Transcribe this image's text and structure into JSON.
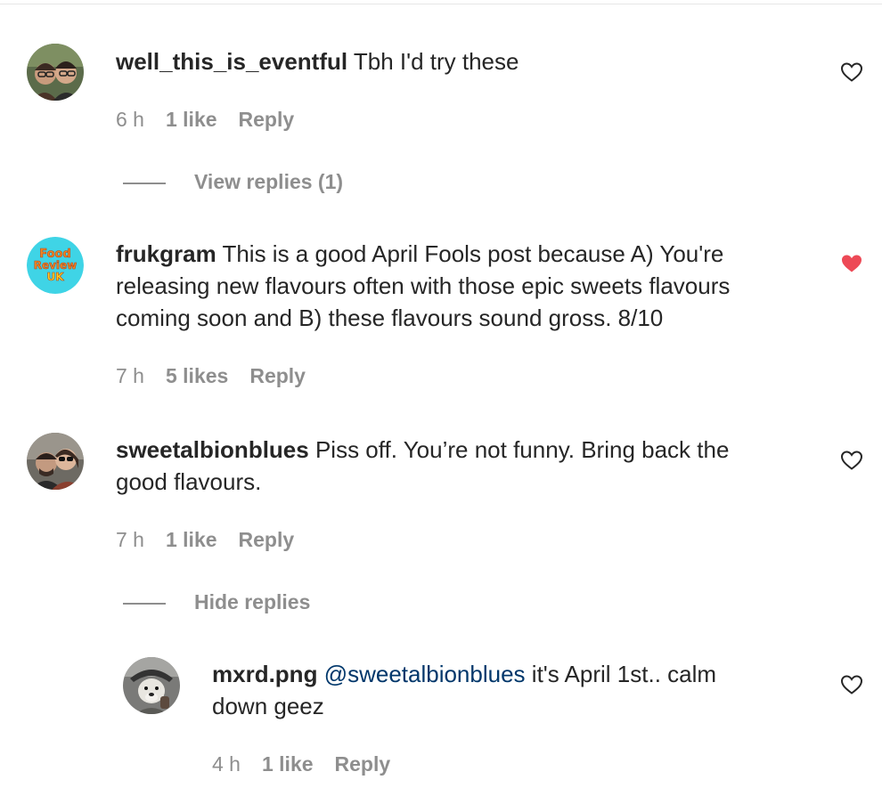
{
  "comments": [
    {
      "username": "well_this_is_eventful",
      "text": "Tbh I'd try these",
      "time": "6 h",
      "likes": "1 like",
      "reply": "Reply",
      "liked": false,
      "replies_toggle": "View replies (1)",
      "avatar_icon": "user-photo-avatar"
    },
    {
      "username": "frukgram",
      "text_line1": "This is a good April Fools post because A) You're",
      "text_line2": "releasing new flavours often with those epic sweets flavours",
      "text_line3": "coming soon and B) these flavours sound gross. 8/10",
      "time": "7 h",
      "likes": "5 likes",
      "reply": "Reply",
      "liked": true,
      "avatar_logo_text": [
        "Food",
        "Review",
        "UK"
      ]
    },
    {
      "username": "sweetalbionblues",
      "text_line1": "Piss off. You’re not funny. Bring back the",
      "text_line2": "good flavours.",
      "time": "7 h",
      "likes": "1 like",
      "reply": "Reply",
      "liked": false,
      "replies_toggle": "Hide replies",
      "avatar_icon": "user-photo-avatar"
    }
  ],
  "reply": {
    "username": "mxrd.png",
    "mention": "@sweetalbionblues",
    "text_line1": "it's April 1st.. calm",
    "text_line2": "down geez",
    "time": "4 h",
    "likes": "1 like",
    "reply": "Reply",
    "liked": false,
    "avatar_icon": "dog-photo-avatar"
  },
  "colors": {
    "liked_heart": "#ed4956",
    "secondary_text": "#8e8e8e",
    "mention": "#00376b"
  }
}
